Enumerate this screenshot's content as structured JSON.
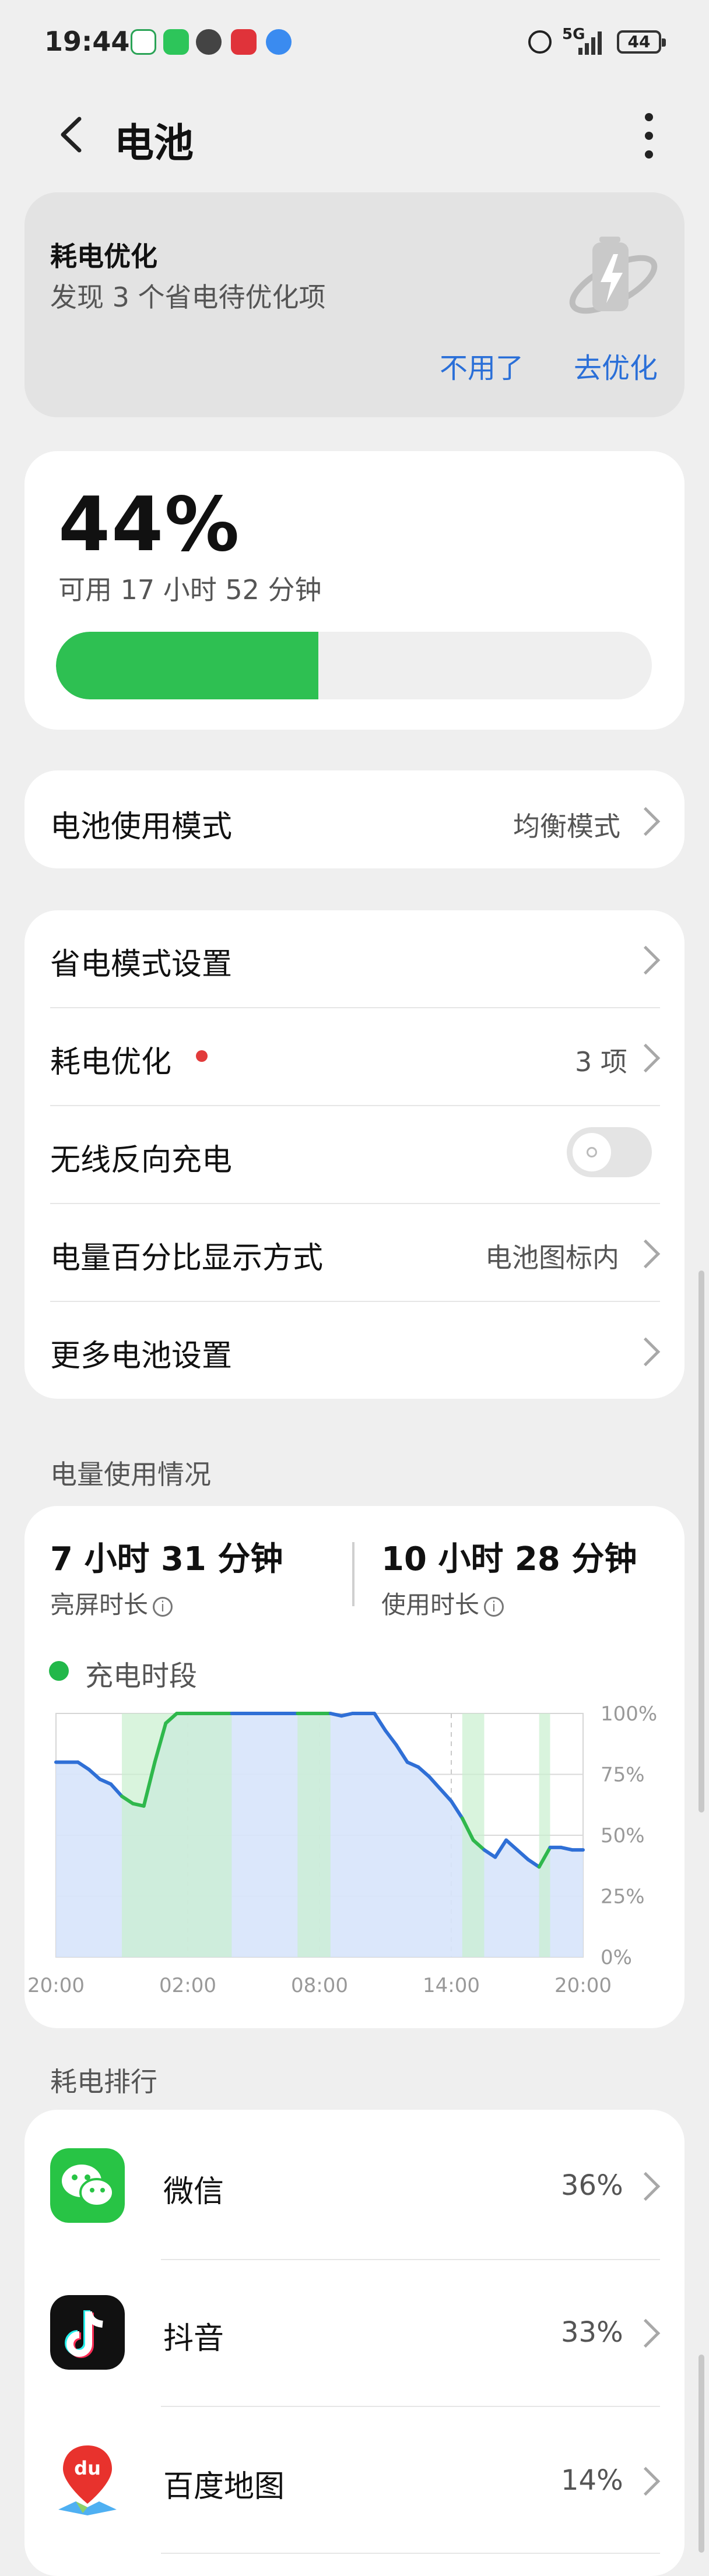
{
  "status_bar": {
    "time": "19:44",
    "network": "5G",
    "battery": "44",
    "notification_icons": [
      "home-app-icon",
      "wechat-icon",
      "vpn-icon",
      "pdd-icon",
      "message-icon"
    ]
  },
  "header": {
    "title": "电池"
  },
  "optimize_card": {
    "title": "耗电优化",
    "subtitle": "发现 3 个省电待优化项",
    "dismiss_label": "不用了",
    "optimize_label": "去优化"
  },
  "battery_status": {
    "percent_label": "44%",
    "percent_value": 44,
    "remaining": "可用 17 小时 52 分钟"
  },
  "mode_row": {
    "label": "电池使用模式",
    "value": "均衡模式"
  },
  "settings": {
    "power_saving": "省电模式设置",
    "optimization": "耗电优化",
    "optimization_value": "3 项",
    "reverse_charging": "无线反向充电",
    "reverse_charging_on": false,
    "percent_display": "电量百分比显示方式",
    "percent_display_value": "电池图标内",
    "more": "更多电池设置"
  },
  "usage": {
    "section_title": "电量使用情况",
    "screen_on_time": "7 小时 31 分钟",
    "screen_on_label": "亮屏时长",
    "usage_time": "10 小时 28 分钟",
    "usage_label": "使用时长",
    "legend_charging": "充电时段"
  },
  "chart_data": {
    "type": "area",
    "x_ticks": [
      "20:00",
      "02:00",
      "08:00",
      "14:00",
      "20:00"
    ],
    "y_ticks": [
      "100%",
      "75%",
      "50%",
      "25%",
      "0%"
    ],
    "ylim": [
      0,
      100
    ],
    "x_hours": [
      0,
      1,
      1.5,
      2,
      2.5,
      3,
      3.5,
      4,
      4.5,
      5,
      5.5,
      6,
      6.5,
      7,
      7.5,
      8,
      8.5,
      9,
      9.5,
      10,
      10.5,
      11,
      11.5,
      12,
      12.5,
      13,
      13.5,
      14,
      14.5,
      15,
      15.5,
      16,
      16.5,
      17,
      17.5,
      18,
      18.5,
      19,
      19.5,
      20,
      20.5,
      21,
      21.5,
      22,
      22.5,
      23,
      23.5,
      24
    ],
    "values": [
      80,
      80,
      77,
      73,
      71,
      66,
      63,
      62,
      80,
      96,
      100,
      100,
      100,
      100,
      100,
      100,
      100,
      100,
      100,
      100,
      100,
      100,
      100,
      100,
      100,
      99,
      100,
      100,
      100,
      93,
      87,
      80,
      78,
      74,
      69,
      64,
      57,
      48,
      44,
      41,
      48,
      44,
      40,
      37,
      45,
      45,
      44,
      44
    ],
    "charging_periods": [
      [
        3,
        8
      ],
      [
        11,
        12.5
      ],
      [
        18.5,
        19.5
      ],
      [
        22,
        22.5
      ]
    ]
  },
  "ranking": {
    "section_title": "耗电排行",
    "apps": [
      {
        "name": "微信",
        "percent": "36%",
        "icon": "wechat-icon"
      },
      {
        "name": "抖音",
        "percent": "33%",
        "icon": "douyin-icon"
      },
      {
        "name": "百度地图",
        "percent": "14%",
        "icon": "baidu-map-icon"
      }
    ]
  }
}
